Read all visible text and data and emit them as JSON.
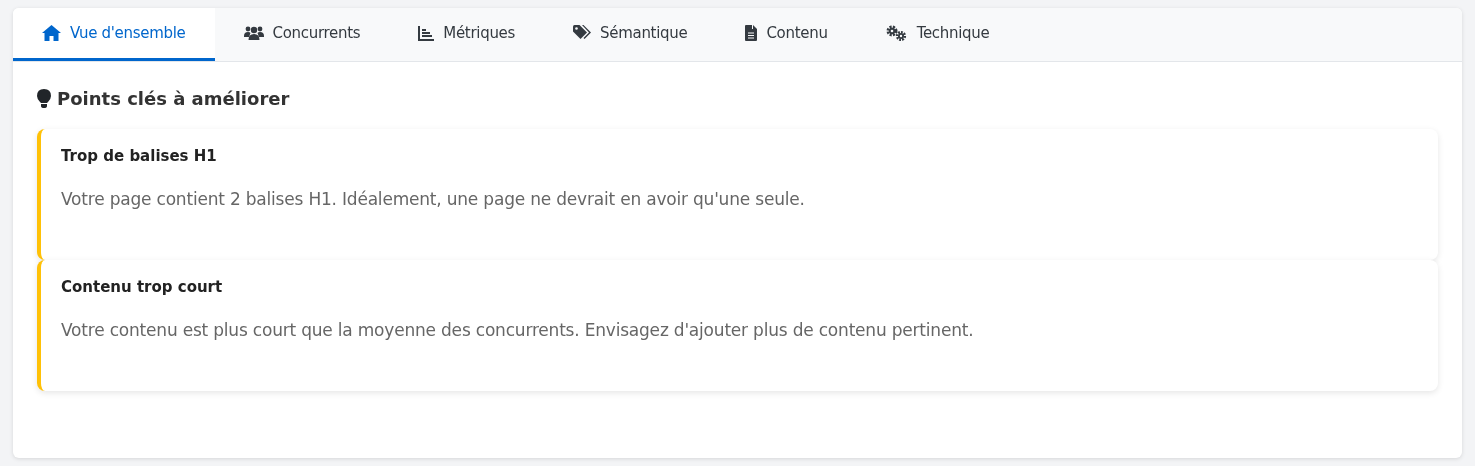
{
  "tabs": [
    {
      "label": "Vue d'ensemble",
      "selected": true
    },
    {
      "label": "Concurrents",
      "selected": false
    },
    {
      "label": "Métriques",
      "selected": false
    },
    {
      "label": "Sémantique",
      "selected": false
    },
    {
      "label": "Contenu",
      "selected": false
    },
    {
      "label": "Technique",
      "selected": false
    }
  ],
  "section": {
    "title": "Points clés à améliorer"
  },
  "alerts": [
    {
      "title": "Trop de balises H1",
      "text": "Votre page contient 2 balises H1. Idéalement, une page ne devrait en avoir qu'une seule."
    },
    {
      "title": "Contenu trop court",
      "text": "Votre contenu est plus court que la moyenne des concurrents. Envisagez d'ajouter plus de contenu pertinent."
    }
  ]
}
